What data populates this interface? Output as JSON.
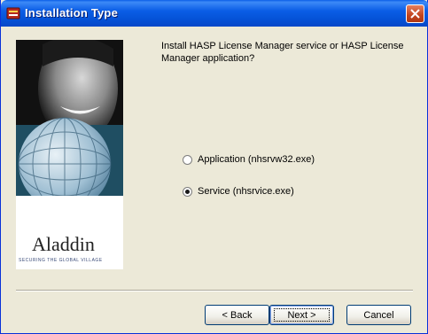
{
  "window": {
    "title": "Installation Type"
  },
  "banner": {
    "logo_text": "Aladdin",
    "tagline": "SECURING THE GLOBAL VILLAGE"
  },
  "main": {
    "question": "Install HASP License Manager service or HASP License Manager application?",
    "options": [
      {
        "label": "Application (nhsrvw32.exe)",
        "selected": false
      },
      {
        "label": "Service (nhsrvice.exe)",
        "selected": true
      }
    ]
  },
  "buttons": {
    "back": "< Back",
    "next": "Next >",
    "cancel": "Cancel"
  }
}
